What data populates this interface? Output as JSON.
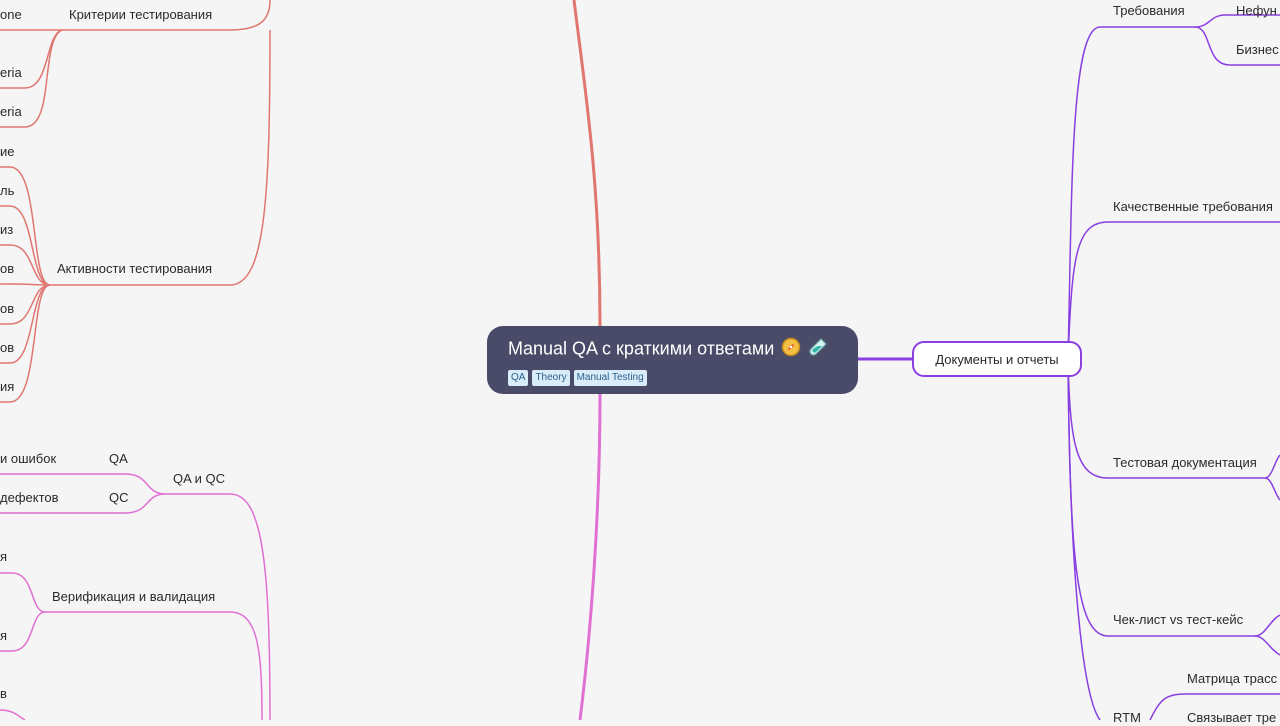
{
  "root": {
    "title": "Manual QA с краткими ответами",
    "emoji_icons": [
      "compass-icon",
      "test-tube-icon"
    ],
    "tags": [
      "QA",
      "Theory",
      "Manual Testing"
    ]
  },
  "right": {
    "main_node": "Документы и отчеты",
    "children": {
      "requirements": "Требования",
      "req_nonfunctional": "Нефун",
      "req_business": "Бизнес",
      "quality_requirements": "Качественные требования",
      "test_documentation": "Тестовая документация",
      "checklist_vs_testcase": "Чек-лист vs тест-кейс",
      "rtm": "RTM",
      "rtm_matrix": "Матрица трасс",
      "rtm_links": "Связывает тре"
    }
  },
  "left": {
    "test_criteria": "Критерии тестирования",
    "tc_child_1": "one",
    "tc_child_2": "eria",
    "tc_child_3": "eria",
    "test_activities": "Активности тестирования",
    "ta_children": [
      "ие",
      "ль",
      "из",
      "ов",
      "ов",
      "ов",
      "ия"
    ],
    "qa_qc": "QA и QC",
    "qa_label": "QA",
    "qc_label": "QC",
    "qa_desc": "и ошибок",
    "qc_desc": "дефектов",
    "verification_validation": "Верификация и валидация",
    "vv_child_1": "я",
    "vv_child_2": "я",
    "bottom_fragment": "в"
  },
  "colors": {
    "background": "#f5f5f5",
    "root_fill": "#4a4b68",
    "tag_fill": "#d8ecf9",
    "branch_red": "#e07670",
    "branch_pink": "#e070d2",
    "branch_purple": "#8a3fe0"
  }
}
